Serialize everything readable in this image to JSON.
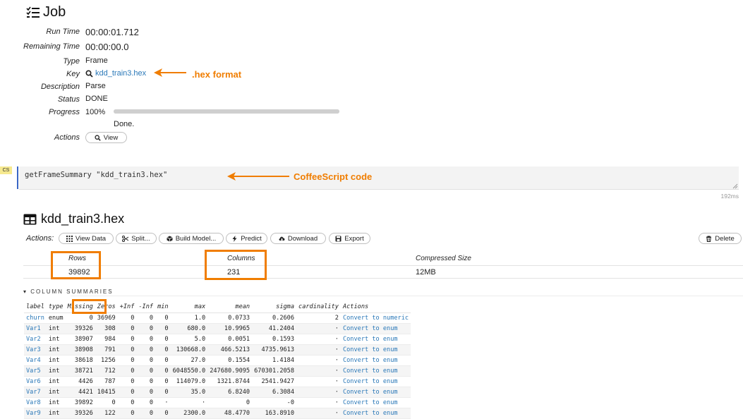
{
  "job": {
    "title": "Job",
    "fields": [
      {
        "label": "Run Time",
        "value": "00:00:01.712"
      },
      {
        "label": "Remaining Time",
        "value": "00:00:00.0"
      },
      {
        "label": "Type",
        "value": "Frame"
      },
      {
        "label": "Key",
        "value": "kdd_train3.hex"
      },
      {
        "label": "Description",
        "value": "Parse"
      },
      {
        "label": "Status",
        "value": "DONE"
      },
      {
        "label": "Progress",
        "value": "100%"
      },
      {
        "label": "Actions",
        "value": ""
      }
    ],
    "progress_fraction": 1.0,
    "progress_message": "Done.",
    "view_button": "View",
    "annotation_hex": ".hex format"
  },
  "cell": {
    "tag": "CS",
    "code": "getFrameSummary \"kdd_train3.hex\"",
    "elapsed": "192ms",
    "annotation_code": "CoffeeScript code"
  },
  "frame": {
    "title": "kdd_train3.hex",
    "actions_label": "Actions:",
    "buttons": [
      "View Data",
      "Split...",
      "Build Model...",
      "Predict",
      "Download",
      "Export"
    ],
    "delete_button": "Delete",
    "summary": {
      "rows_label": "Rows",
      "rows_value": "39892",
      "columns_label": "Columns",
      "columns_value": "231",
      "size_label": "Compressed Size",
      "size_value": "12MB"
    },
    "column_summaries_title": "COLUMN SUMMARIES",
    "column_headers": [
      "label",
      "type",
      "Missing",
      "Zeros",
      "+Inf",
      "-Inf",
      "min",
      "max",
      "mean",
      "sigma",
      "cardinality",
      "Actions"
    ],
    "columns": [
      [
        "churn",
        "enum",
        "0",
        "36969",
        "0",
        "0",
        "0",
        "1.0",
        "0.0733",
        "0.2606",
        "2",
        "Convert to numeric"
      ],
      [
        "Var1",
        "int",
        "39326",
        "308",
        "0",
        "0",
        "0",
        "680.0",
        "10.9965",
        "41.2404",
        "·",
        "Convert to enum"
      ],
      [
        "Var2",
        "int",
        "38907",
        "984",
        "0",
        "0",
        "0",
        "5.0",
        "0.0051",
        "0.1593",
        "·",
        "Convert to enum"
      ],
      [
        "Var3",
        "int",
        "38908",
        "791",
        "0",
        "0",
        "0",
        "130668.0",
        "466.5213",
        "4735.9613",
        "·",
        "Convert to enum"
      ],
      [
        "Var4",
        "int",
        "38618",
        "1256",
        "0",
        "0",
        "0",
        "27.0",
        "0.1554",
        "1.4184",
        "·",
        "Convert to enum"
      ],
      [
        "Var5",
        "int",
        "38721",
        "712",
        "0",
        "0",
        "0",
        "6048550.0",
        "247680.9095",
        "670301.2058",
        "·",
        "Convert to enum"
      ],
      [
        "Var6",
        "int",
        "4426",
        "787",
        "0",
        "0",
        "0",
        "114079.0",
        "1321.8744",
        "2541.9427",
        "·",
        "Convert to enum"
      ],
      [
        "Var7",
        "int",
        "4421",
        "10415",
        "0",
        "0",
        "0",
        "35.0",
        "6.8240",
        "6.3084",
        "·",
        "Convert to enum"
      ],
      [
        "Var8",
        "int",
        "39892",
        "0",
        "0",
        "0",
        "·",
        "·",
        "0",
        "-0",
        "·",
        "Convert to enum"
      ],
      [
        "Var9",
        "int",
        "39326",
        "122",
        "0",
        "0",
        "0",
        "2300.0",
        "48.4770",
        "163.8910",
        "·",
        "Convert to enum"
      ]
    ]
  }
}
